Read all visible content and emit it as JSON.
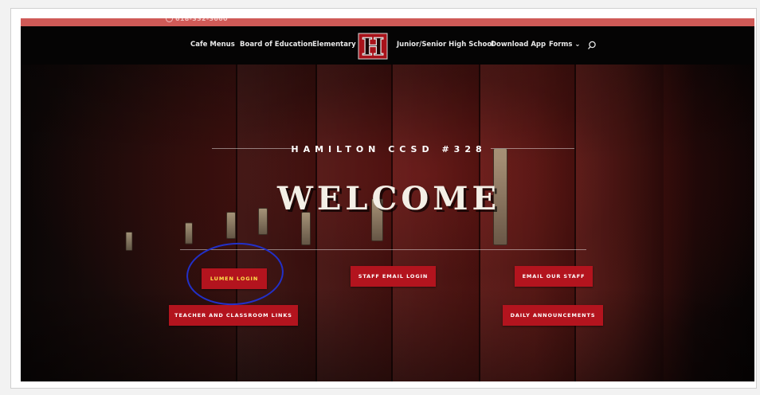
{
  "topbar": {
    "phone": "618-332-3660"
  },
  "nav": {
    "items": [
      {
        "label": "Cafe Menus"
      },
      {
        "label": "Board of Education"
      },
      {
        "label": "Elementary"
      },
      {
        "label": "Junior/Senior High School"
      },
      {
        "label": "Download App"
      },
      {
        "label": "Forms ⌄"
      }
    ],
    "logo_letter": "H",
    "search_icon": "search-icon"
  },
  "hero": {
    "district": "HAMILTON CCSD #328",
    "welcome": "WELCOME",
    "buttons": [
      {
        "label": "LUMEN LOGIN"
      },
      {
        "label": "STAFF EMAIL LOGIN"
      },
      {
        "label": "EMAIL OUR STAFF"
      },
      {
        "label": "TEACHER AND CLASSROOM LINKS"
      },
      {
        "label": "DAILY ANNOUNCEMENTS"
      }
    ]
  },
  "colors": {
    "topbar": "#cf5a57",
    "button": "#b3141e",
    "highlight_text": "#ffe64a",
    "annotation_circle": "#2230c8"
  }
}
